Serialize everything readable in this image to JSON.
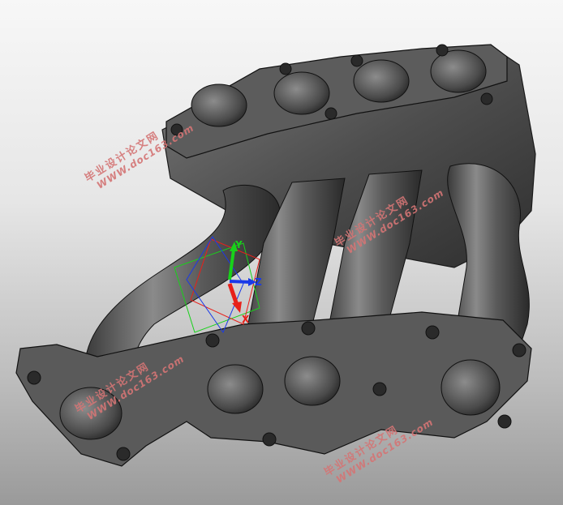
{
  "triad": {
    "x_label": "X",
    "y_label": "Y",
    "z_label": "Z",
    "x_color": "#e8201a",
    "y_color": "#18d21a",
    "z_color": "#1a3ae8"
  },
  "watermarks": [
    {
      "cn": "毕业设计论文网",
      "url": "WWW.doc163.com"
    },
    {
      "cn": "毕业设计论文网",
      "url": "WWW.doc163.com"
    },
    {
      "cn": "毕业设计论文网",
      "url": "WWW.doc163.com"
    },
    {
      "cn": "毕业设计论文网",
      "url": "WWW.doc163.com"
    }
  ],
  "model": {
    "surface_color": "#5a5a5a",
    "edge_color": "#1a1a1a"
  }
}
